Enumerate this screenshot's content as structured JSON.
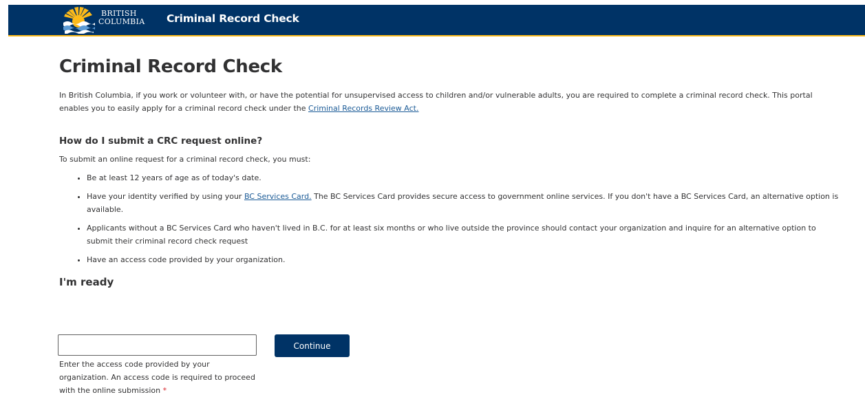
{
  "header": {
    "logo_line1": "BRITISH",
    "logo_line2": "COLUMBIA",
    "title": "Criminal Record Check"
  },
  "main": {
    "page_title": "Criminal Record Check",
    "intro_text": "In British Columbia, if you work or volunteer with, or have the potential for unsupervised access to children and/or vulnerable adults, you are required to complete a criminal record check. This portal enables you to easily apply for a criminal record check under the ",
    "intro_link": "Criminal Records Review Act.",
    "section_title": "How do I submit a CRC request online?",
    "section_intro": "To submit an online request for a criminal record check, you must:",
    "bullets": {
      "item1": "Be at least 12 years of age as of today's date.",
      "item2_pre": "Have your identity verified by using your ",
      "item2_link": "BC Services Card.",
      "item2_post": " The BC Services Card provides secure access to government online services. If you don't have a BC Services Card, an alternative option is available.",
      "item3": "Applicants without a BC Services Card who haven't lived in B.C. for at least six months or who live outside the province should contact your organization and inquire for an alternative option to submit their criminal record check request",
      "item4": "Have an access code provided by your organization."
    },
    "ready_title": "I'm ready"
  },
  "form": {
    "access_code_value": "",
    "continue_label": "Continue",
    "help_text": "Enter the access code provided by your organization. An access code is required to proceed with the online submission",
    "required_marker": "*"
  },
  "colors": {
    "header_bg": "#003366",
    "header_accent": "#fcba19",
    "link": "#1a5a96",
    "required": "#d8292f"
  }
}
